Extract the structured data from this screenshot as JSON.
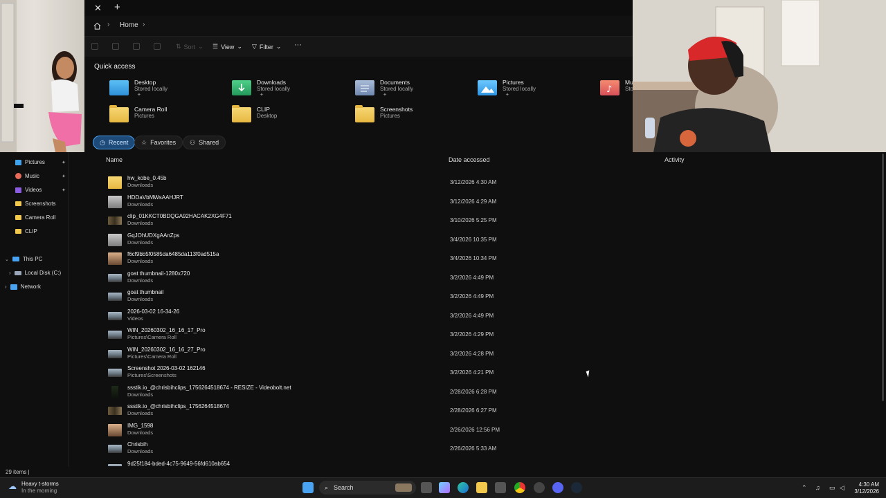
{
  "titlebar": {
    "close_glyph": "✕",
    "new_tab_glyph": "+"
  },
  "address": {
    "breadcrumb": [
      "Home"
    ]
  },
  "toolbar": {
    "sort": "Sort",
    "view": "View",
    "filter": "Filter",
    "more": "···"
  },
  "quick_access": {
    "title": "Quick access",
    "items": [
      {
        "name": "Desktop",
        "sub": "Stored locally",
        "icon": "desktop-folder-icon",
        "color": "#3aa0e8"
      },
      {
        "name": "Downloads",
        "sub": "Stored locally",
        "icon": "downloads-folder-icon",
        "color": "#2fb36f"
      },
      {
        "name": "Documents",
        "sub": "Stored locally",
        "icon": "documents-folder-icon",
        "color": "#8aa2c8"
      },
      {
        "name": "Pictures",
        "sub": "Stored locally",
        "icon": "pictures-folder-icon",
        "color": "#4ab0f0"
      },
      {
        "name": "Mu",
        "sub": "Sto",
        "icon": "music-folder-icon",
        "color": "#e86a5a"
      },
      {
        "name": "Camera Roll",
        "sub": "Pictures",
        "icon": "folder-icon",
        "color": "#f2c94c"
      },
      {
        "name": "CLIP",
        "sub": "Desktop",
        "icon": "folder-icon",
        "color": "#f2c94c"
      },
      {
        "name": "Screenshots",
        "sub": "Pictures",
        "icon": "folder-icon",
        "color": "#f2c94c"
      }
    ]
  },
  "tabs": {
    "recent": "Recent",
    "favorites": "Favorites",
    "shared": "Shared"
  },
  "sidebar": {
    "items": [
      {
        "label": "Pictures",
        "pinned": true
      },
      {
        "label": "Music",
        "pinned": true
      },
      {
        "label": "Videos",
        "pinned": true
      },
      {
        "label": "Screenshots",
        "pinned": false
      },
      {
        "label": "Camera Roll",
        "pinned": false
      },
      {
        "label": "CLIP",
        "pinned": false
      },
      {
        "label": "This PC",
        "pinned": false
      },
      {
        "label": "Local Disk (C:)",
        "pinned": false
      },
      {
        "label": "Network",
        "pinned": false
      }
    ]
  },
  "list": {
    "columns": {
      "name": "Name",
      "date": "Date accessed",
      "activity": "Activity"
    },
    "rows": [
      {
        "name": "hw_kobe_0.45b",
        "location": "Downloads",
        "date": "3/12/2026 4:30 AM",
        "kind": "folder"
      },
      {
        "name": "HDDaVbMWsAAHJRT",
        "location": "Downloads",
        "date": "3/12/2026 4:29 AM",
        "kind": "image-light"
      },
      {
        "name": "clip_01KKCT0BDQGA92HACAK2XG4F71",
        "location": "Downloads",
        "date": "3/10/2026 5:25 PM",
        "kind": "video"
      },
      {
        "name": "GqJOhUDXgAAnZps",
        "location": "Downloads",
        "date": "3/4/2026 10:35 PM",
        "kind": "image-light"
      },
      {
        "name": "f6cf9bb5f0585da6485da113f0ad515a",
        "location": "Downloads",
        "date": "3/4/2026 10:34 PM",
        "kind": "image-person"
      },
      {
        "name": "goat thumbnail-1280x720",
        "location": "Downloads",
        "date": "3/2/2026 4:49 PM",
        "kind": "image-wide"
      },
      {
        "name": "goat thumbnail",
        "location": "Downloads",
        "date": "3/2/2026 4:49 PM",
        "kind": "image-wide"
      },
      {
        "name": "2026-03-02 16-34-26",
        "location": "Videos",
        "date": "3/2/2026 4:49 PM",
        "kind": "image-wide"
      },
      {
        "name": "WIN_20260302_16_16_17_Pro",
        "location": "Pictures\\Camera Roll",
        "date": "3/2/2026 4:29 PM",
        "kind": "image-wide"
      },
      {
        "name": "WIN_20260302_16_16_27_Pro",
        "location": "Pictures\\Camera Roll",
        "date": "3/2/2026 4:28 PM",
        "kind": "image-wide"
      },
      {
        "name": "Screenshot 2026-03-02 162146",
        "location": "Pictures\\Screenshots",
        "date": "3/2/2026 4:21 PM",
        "kind": "image-wide"
      },
      {
        "name": "ssstik.io_@chrisbihclips_1756264518674 - RESIZE - Videobolt.net",
        "location": "Downloads",
        "date": "2/28/2026 6:28 PM",
        "kind": "video-dark"
      },
      {
        "name": "ssstik.io_@chrisbihclips_1756264518674",
        "location": "Downloads",
        "date": "2/28/2026 6:27 PM",
        "kind": "video"
      },
      {
        "name": "IMG_1598",
        "location": "Downloads",
        "date": "2/26/2026 12:56 PM",
        "kind": "image-person"
      },
      {
        "name": "Chrisbih",
        "location": "Downloads",
        "date": "2/26/2026 5:33 AM",
        "kind": "image-wide"
      },
      {
        "name": "9d25f184-bded-4c75-9649-56fd610ab654",
        "location": "",
        "date": "",
        "kind": "image-wide"
      }
    ]
  },
  "status": {
    "items": "29 items"
  },
  "taskbar": {
    "weather_title": "Heavy t-storms",
    "weather_sub": "In the morning",
    "search": "Search",
    "time": "4:30 AM",
    "date": "3/12/2026"
  }
}
